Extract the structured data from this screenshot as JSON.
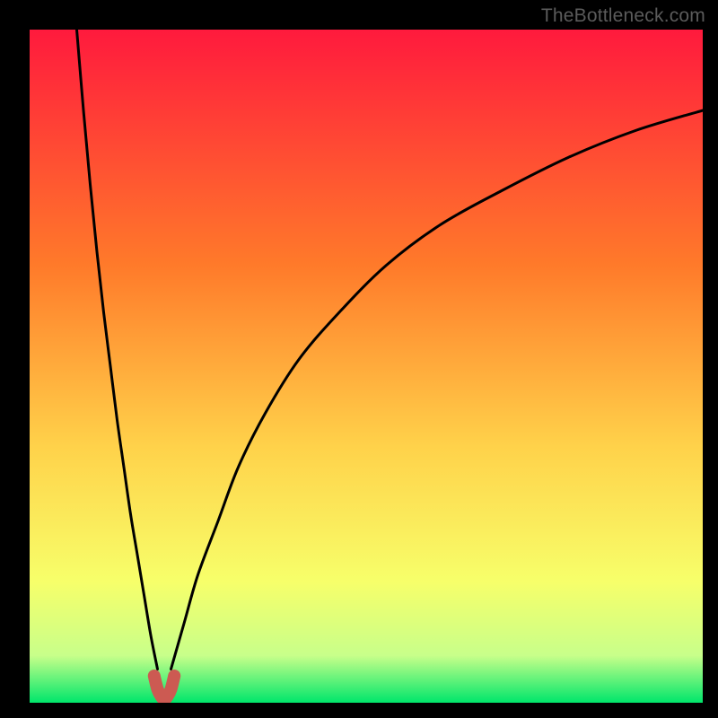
{
  "watermark": "TheBottleneck.com",
  "colors": {
    "frame": "#000000",
    "gradient_top": "#ff1a3d",
    "gradient_mid1": "#ff7a2a",
    "gradient_mid2": "#ffd24a",
    "gradient_mid3": "#f7ff6a",
    "gradient_mid4": "#c8ff8a",
    "gradient_bottom": "#00e66b",
    "curve": "#000000",
    "marker": "#cc5a52"
  },
  "chart_data": {
    "type": "line",
    "title": "",
    "xlabel": "",
    "ylabel": "",
    "xlim": [
      0,
      100
    ],
    "ylim": [
      0,
      100
    ],
    "optimum_x": 20,
    "series": [
      {
        "name": "left-branch",
        "x": [
          7,
          8,
          9,
          10,
          11,
          12,
          13,
          14,
          15,
          16,
          17,
          18,
          19
        ],
        "values": [
          100,
          88,
          77,
          67,
          58,
          50,
          42,
          35,
          28,
          22,
          16,
          10,
          5
        ]
      },
      {
        "name": "right-branch",
        "x": [
          21,
          23,
          25,
          28,
          31,
          35,
          40,
          46,
          53,
          61,
          70,
          80,
          90,
          100
        ],
        "values": [
          5,
          12,
          19,
          27,
          35,
          43,
          51,
          58,
          65,
          71,
          76,
          81,
          85,
          88
        ]
      },
      {
        "name": "valley-marker",
        "x": [
          18.5,
          19,
          19.5,
          20,
          20.5,
          21,
          21.5
        ],
        "values": [
          4,
          2,
          1,
          0.5,
          1,
          2,
          4
        ]
      }
    ]
  }
}
